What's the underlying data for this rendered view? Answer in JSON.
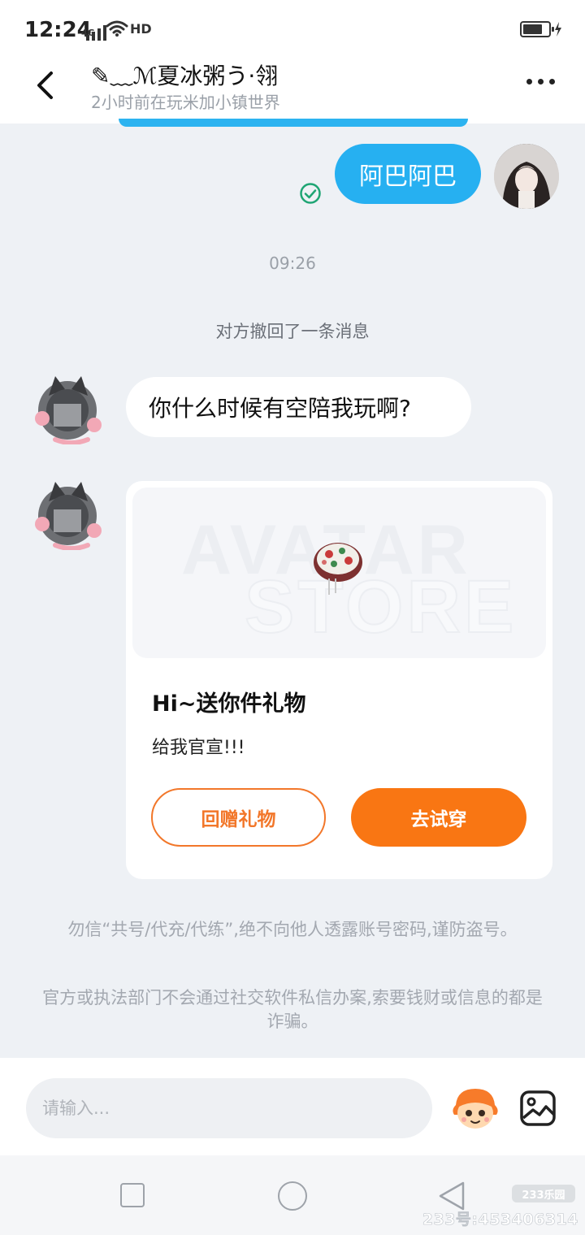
{
  "status_bar": {
    "time": "12:24",
    "network": "4G",
    "hd": "HD",
    "battery_level": 0.75
  },
  "header": {
    "contact_name": "✎﹏ℳ夏冰粥う·翎",
    "contact_status": "2小时前在玩米加小镇世界"
  },
  "messages": {
    "sent_text": "阿巴阿巴",
    "time_divider": "09:26",
    "recall_notice": "对方撤回了一条消息",
    "received_text": "你什么时候有空陪我玩啊?"
  },
  "gift_card": {
    "banner_word_1": "AVATAR",
    "banner_word_2": "STORE",
    "title": "Hi~送你件礼物",
    "message": "给我官宣!!!",
    "return_gift_label": "回赠礼物",
    "try_on_label": "去试穿",
    "accent_color": "#f97613"
  },
  "safety_notices": [
    "勿信“共号/代充/代练”,绝不向他人透露账号密码,谨防盗号。",
    "官方或执法部门不会通过社交软件私信办案,索要钱财或信息的都是诈骗。"
  ],
  "input_bar": {
    "placeholder": "请输入..."
  },
  "watermark": {
    "logo": "233乐园",
    "id_text": "233号:453406314"
  }
}
